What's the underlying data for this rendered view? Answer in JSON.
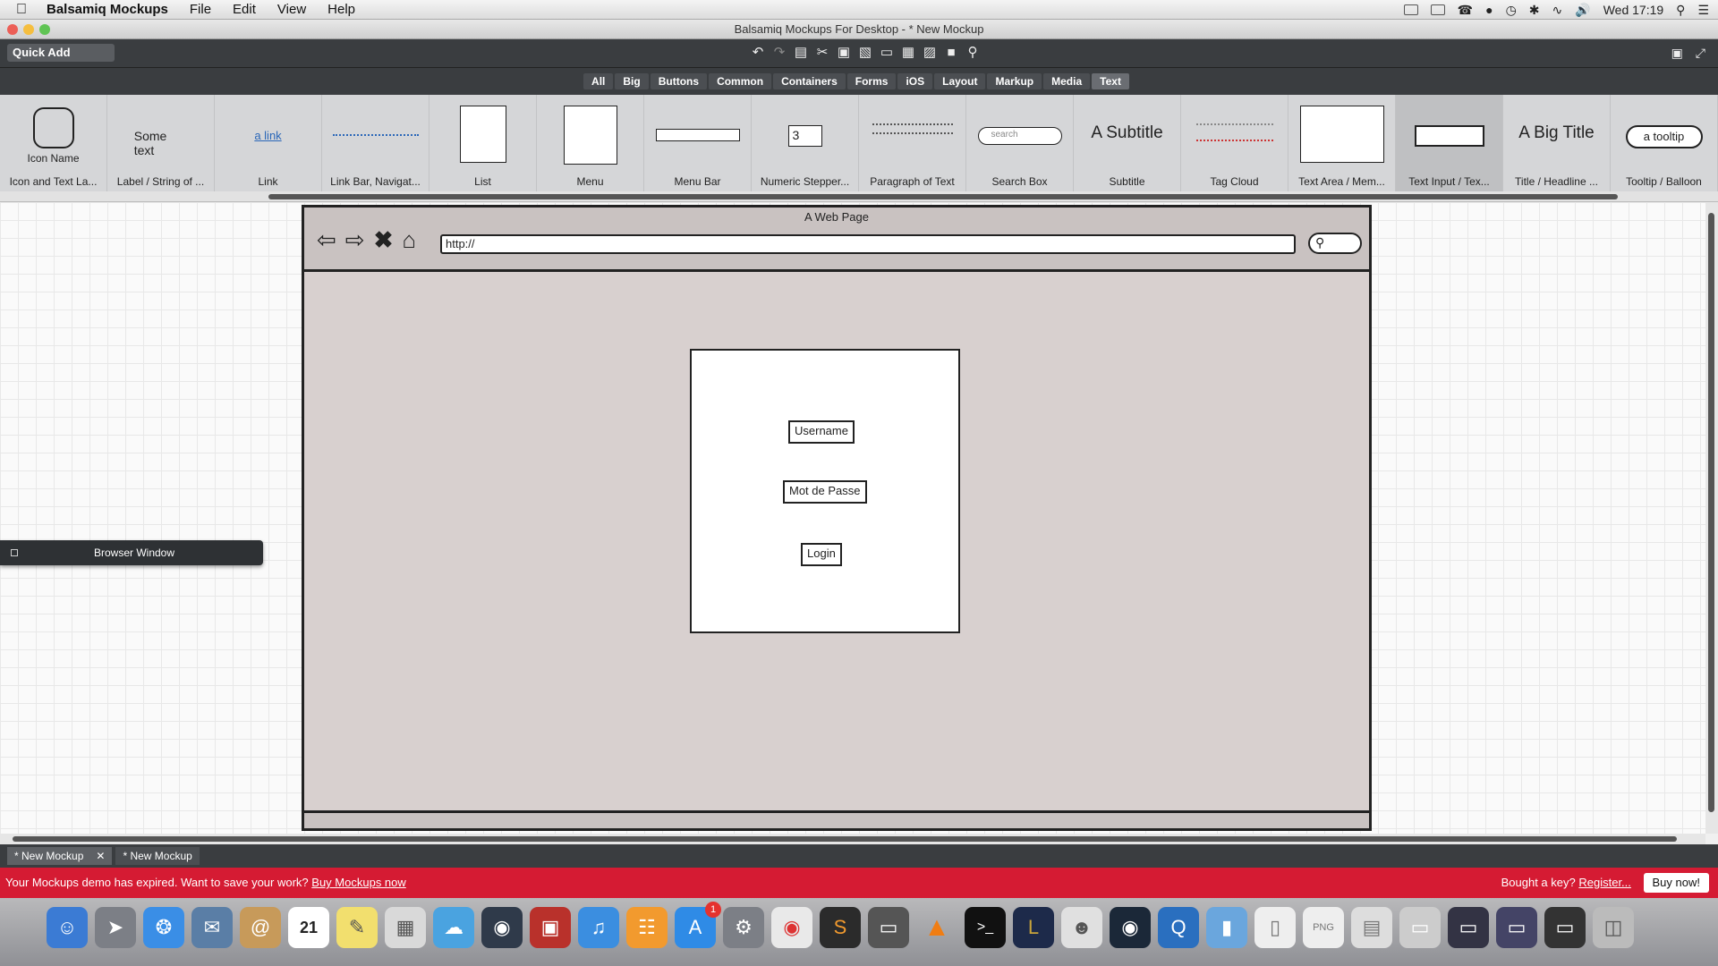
{
  "menubar": {
    "app": "Balsamiq Mockups",
    "items": [
      "File",
      "Edit",
      "View",
      "Help"
    ],
    "clock": "Wed 17:19"
  },
  "window": {
    "title": "Balsamiq Mockups For Desktop - * New Mockup"
  },
  "toolbar": {
    "quick_add": "Quick Add"
  },
  "categories": [
    "All",
    "Big",
    "Buttons",
    "Common",
    "Containers",
    "Forms",
    "iOS",
    "Layout",
    "Markup",
    "Media",
    "Text"
  ],
  "selected_category": "Text",
  "library": [
    {
      "label": "Icon and Text La...",
      "preview": "Icon Name"
    },
    {
      "label": "Label / String of ...",
      "preview": "Some text"
    },
    {
      "label": "Link",
      "preview": "a link"
    },
    {
      "label": "Link Bar, Navigat...",
      "preview": ""
    },
    {
      "label": "List",
      "preview": ""
    },
    {
      "label": "Menu",
      "preview": ""
    },
    {
      "label": "Menu Bar",
      "preview": ""
    },
    {
      "label": "Numeric Stepper...",
      "preview": "3"
    },
    {
      "label": "Paragraph of Text",
      "preview": ""
    },
    {
      "label": "Search Box",
      "preview": "search"
    },
    {
      "label": "Subtitle",
      "preview": "A Subtitle"
    },
    {
      "label": "Tag Cloud",
      "preview": ""
    },
    {
      "label": "Text Area / Mem...",
      "preview": ""
    },
    {
      "label": "Text Input / Tex...",
      "preview": ""
    },
    {
      "label": "Title / Headline ...",
      "preview": "A Big Title"
    },
    {
      "label": "Tooltip / Balloon",
      "preview": "a tooltip"
    }
  ],
  "selected_library_item": "Text Input / Tex...",
  "mockup": {
    "browser_title": "A Web Page",
    "url": "http://",
    "fields": {
      "username": "Username",
      "password": "Mot de Passe",
      "login": "Login"
    }
  },
  "panel": {
    "title": "Browser Window"
  },
  "tabs": [
    "* New Mockup",
    "* New Mockup"
  ],
  "notice": {
    "text": "Your Mockups demo has expired. Want to save your work?",
    "link": "Buy Mockups now",
    "right_text": "Bought a key?",
    "right_link": "Register...",
    "button": "Buy now!"
  },
  "dock": {
    "calendar_day": "21",
    "badge": "1"
  }
}
